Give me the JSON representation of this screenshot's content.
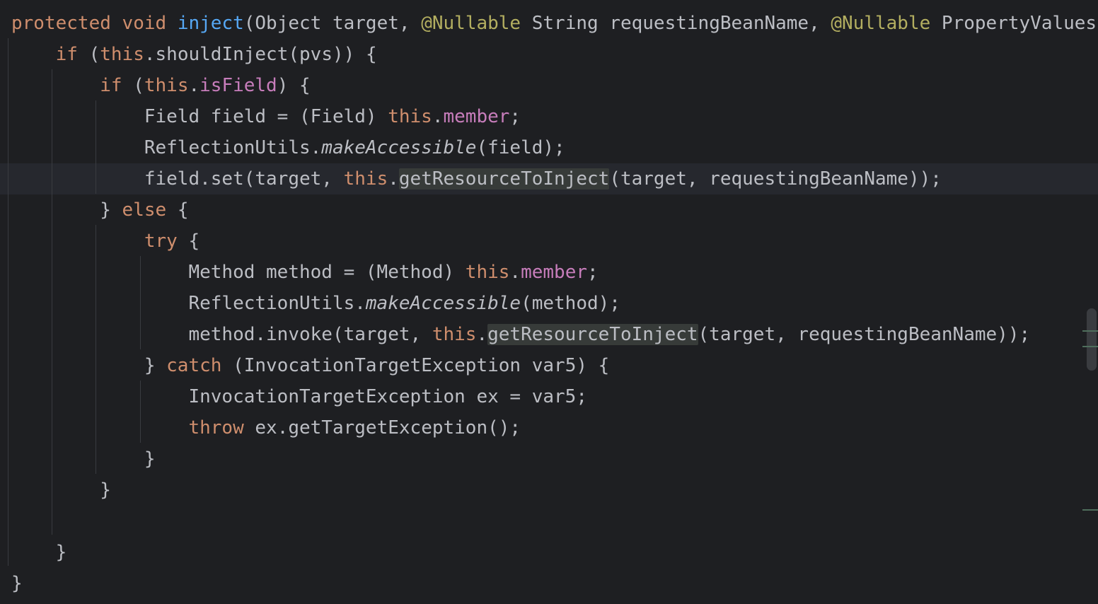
{
  "editor": {
    "lines": [
      [
        {
          "t": "protected",
          "c": "kw"
        },
        {
          "t": " "
        },
        {
          "t": "void",
          "c": "kw"
        },
        {
          "t": " "
        },
        {
          "t": "inject",
          "c": "fn-decl"
        },
        {
          "t": "(Object target, "
        },
        {
          "t": "@Nullable",
          "c": "ann"
        },
        {
          "t": " String requestingBeanName, "
        },
        {
          "t": "@Nullable",
          "c": "ann"
        },
        {
          "t": " PropertyValues"
        }
      ],
      [
        {
          "t": "    "
        },
        {
          "t": "if",
          "c": "kw"
        },
        {
          "t": " ("
        },
        {
          "t": "this",
          "c": "kw"
        },
        {
          "t": ".shouldInject(pvs)) {"
        }
      ],
      [
        {
          "t": "        "
        },
        {
          "t": "if",
          "c": "kw"
        },
        {
          "t": " ("
        },
        {
          "t": "this",
          "c": "kw"
        },
        {
          "t": "."
        },
        {
          "t": "isField",
          "c": "fld"
        },
        {
          "t": ") {"
        }
      ],
      [
        {
          "t": "            Field field = (Field) "
        },
        {
          "t": "this",
          "c": "kw"
        },
        {
          "t": "."
        },
        {
          "t": "member",
          "c": "fld"
        },
        {
          "t": ";"
        }
      ],
      [
        {
          "t": "            ReflectionUtils."
        },
        {
          "t": "makeAccessible",
          "c": "ital"
        },
        {
          "t": "(field);"
        }
      ],
      [
        {
          "t": "            field.set(target, "
        },
        {
          "t": "this",
          "c": "kw"
        },
        {
          "t": "."
        },
        {
          "t": "getResourceToInject",
          "c": "hl"
        },
        {
          "t": "(target, requestingBeanName));"
        }
      ],
      [
        {
          "t": "        } "
        },
        {
          "t": "else",
          "c": "kw"
        },
        {
          "t": " {"
        }
      ],
      [
        {
          "t": "            "
        },
        {
          "t": "try",
          "c": "kw"
        },
        {
          "t": " {"
        }
      ],
      [
        {
          "t": "                Method method = (Method) "
        },
        {
          "t": "this",
          "c": "kw"
        },
        {
          "t": "."
        },
        {
          "t": "member",
          "c": "fld"
        },
        {
          "t": ";"
        }
      ],
      [
        {
          "t": "                ReflectionUtils."
        },
        {
          "t": "makeAccessible",
          "c": "ital"
        },
        {
          "t": "(method);"
        }
      ],
      [
        {
          "t": "                method.invoke(target, "
        },
        {
          "t": "this",
          "c": "kw"
        },
        {
          "t": "."
        },
        {
          "t": "getResourceToInject",
          "c": "hl"
        },
        {
          "t": "(target, requestingBeanName));"
        }
      ],
      [
        {
          "t": "            } "
        },
        {
          "t": "catch",
          "c": "kw"
        },
        {
          "t": " (InvocationTargetException var5) {"
        }
      ],
      [
        {
          "t": "                InvocationTargetException ex = var5;"
        }
      ],
      [
        {
          "t": "                "
        },
        {
          "t": "throw",
          "c": "kw"
        },
        {
          "t": " ex.getTargetException();"
        }
      ],
      [
        {
          "t": "            }"
        }
      ],
      [
        {
          "t": "        }"
        }
      ],
      [],
      [
        {
          "t": "    }"
        }
      ],
      [
        {
          "t": "}"
        }
      ]
    ],
    "current_line_index": 5
  },
  "colors": {
    "background": "#1e1f22",
    "text": "#bcbec4",
    "keyword": "#cf8e6d",
    "annotation": "#b3ae60",
    "method_declaration": "#56a8f5",
    "field": "#c77dbb",
    "usage_highlight": "#373b39",
    "current_line": "#26282e"
  }
}
